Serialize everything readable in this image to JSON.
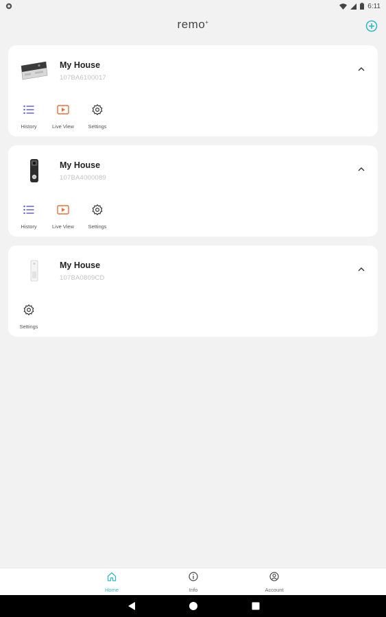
{
  "status_bar": {
    "time": "6:11",
    "icons": [
      "notification-dot-icon",
      "wifi-icon",
      "signal-icon",
      "battery-icon"
    ]
  },
  "app_bar": {
    "title": "remo",
    "title_mark": "+",
    "add_icon": "add-circle-icon"
  },
  "devices": [
    {
      "name": "My House",
      "serial": "107BA6100017",
      "icon": "chevron-up-icon",
      "actions": [
        {
          "label": "History",
          "icon": "list-icon"
        },
        {
          "label": "Live View",
          "icon": "play-icon"
        },
        {
          "label": "Settings",
          "icon": "gear-icon"
        }
      ]
    },
    {
      "name": "My House",
      "serial": "107BA4000089",
      "icon": "chevron-up-icon",
      "actions": [
        {
          "label": "History",
          "icon": "list-icon"
        },
        {
          "label": "Live View",
          "icon": "play-icon"
        },
        {
          "label": "Settings",
          "icon": "gear-icon"
        }
      ]
    },
    {
      "name": "My House",
      "serial": "107BA0809CD",
      "icon": "chevron-up-icon",
      "actions": [
        {
          "label": "Settings",
          "icon": "gear-icon"
        }
      ]
    }
  ],
  "bottom_nav": {
    "items": [
      {
        "label": "Home",
        "icon": "home-icon",
        "active": true
      },
      {
        "label": "Info",
        "icon": "info-icon",
        "active": false
      },
      {
        "label": "Account",
        "icon": "account-icon",
        "active": false
      }
    ]
  },
  "colors": {
    "accent": "#32b8c8",
    "history": "#5a55d6",
    "live_view": "#e8703a",
    "background": "#f2f2f2",
    "card": "#ffffff"
  }
}
